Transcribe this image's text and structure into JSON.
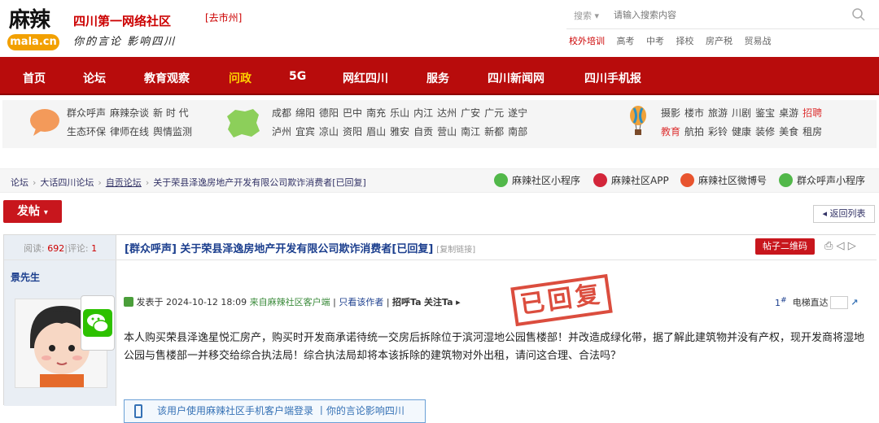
{
  "header": {
    "logo_main": "麻辣",
    "logo_sub": "mala.cn",
    "site_name": "四川第一网络社区",
    "city": "[去市州]",
    "slogan": "你的言论 影响四川",
    "search": {
      "type_label": "搜索",
      "placeholder": "请输入搜索内容"
    },
    "hot_links": [
      "校外培训",
      "高考",
      "中考",
      "择校",
      "房产税",
      "贸易战"
    ]
  },
  "nav": {
    "items": [
      {
        "label": "首页"
      },
      {
        "label": "论坛"
      },
      {
        "label": "教育观察"
      },
      {
        "label": "问政",
        "active": true
      },
      {
        "label": "5G"
      },
      {
        "label": "网红四川"
      },
      {
        "label": "服务"
      },
      {
        "label": "四川新闻网"
      },
      {
        "label": "四川手机报"
      }
    ]
  },
  "channels": {
    "group1": {
      "row1": [
        "群众呼声",
        "麻辣杂谈",
        "新 时 代"
      ],
      "row2": [
        "生态环保",
        "律师在线",
        "舆情监测"
      ]
    },
    "group2": {
      "row1": [
        "成都",
        "绵阳",
        "德阳",
        "巴中",
        "南充",
        "乐山",
        "内江",
        "达州",
        "广安",
        "广元",
        "遂宁"
      ],
      "row2": [
        "泸州",
        "宜宾",
        "凉山",
        "资阳",
        "眉山",
        "雅安",
        "自贡",
        "营山",
        "南江",
        "新都",
        "南部"
      ]
    },
    "group3": {
      "row1": [
        "摄影",
        "楼市",
        "旅游",
        "川剧",
        "鉴宝",
        "桌游",
        "招聘"
      ],
      "row2": [
        "教育",
        "航拍",
        "彩铃",
        "健康",
        "装修",
        "美食",
        "租房"
      ]
    }
  },
  "breadcrumb": [
    "论坛",
    "大话四川论坛",
    "自贡论坛",
    "关于荣县泽逸房地产开发有限公司欺诈消费者[已回复]"
  ],
  "services": [
    {
      "label": "麻辣社区小程序",
      "color": "#52b84a"
    },
    {
      "label": "麻辣社区APP",
      "color": "#d3263a",
      "badge": "APP"
    },
    {
      "label": "麻辣社区微博号",
      "color": "#e8542e"
    },
    {
      "label": "群众呼声小程序",
      "color": "#52b84a"
    }
  ],
  "actions": {
    "post": "发帖",
    "back": "返回列表"
  },
  "thread": {
    "views_label": "阅读:",
    "views": "692",
    "replies_label": "评论:",
    "replies": "1",
    "title": "[群众呼声] 关于荣县泽逸房地产开发有限公司欺诈消费者[已回复]",
    "copy_link": "[复制链接]",
    "qr_label": "帖子二维码",
    "author": "景先生",
    "posted_prefix": "发表于",
    "posted_time": "2024-10-12 18:09",
    "client": "来自麻辣社区客户端",
    "only_author": "只看该作者",
    "greet": "招呼Ta",
    "follow": "关注Ta",
    "floor": "1",
    "elevator": "电梯直达",
    "stamp": "已回复",
    "content": "本人购买荣县泽逸星悦汇房产，购买时开发商承诺待统一交房后拆除位于滨河湿地公园售楼部！并改造成绿化带，据了解此建筑物并没有产权，现开发商将湿地公园与售楼部一并移交给综合执法局！综合执法局却将本该拆除的建筑物对外出租，请问这合理、合法吗？",
    "mobile_note": "该用户使用麻辣社区手机客户端登录 丨你的言论影响四川"
  },
  "colors": {
    "brand_red": "#b80c0c",
    "link_blue": "#1c3f8e",
    "accent_yellow": "#ffd200"
  }
}
